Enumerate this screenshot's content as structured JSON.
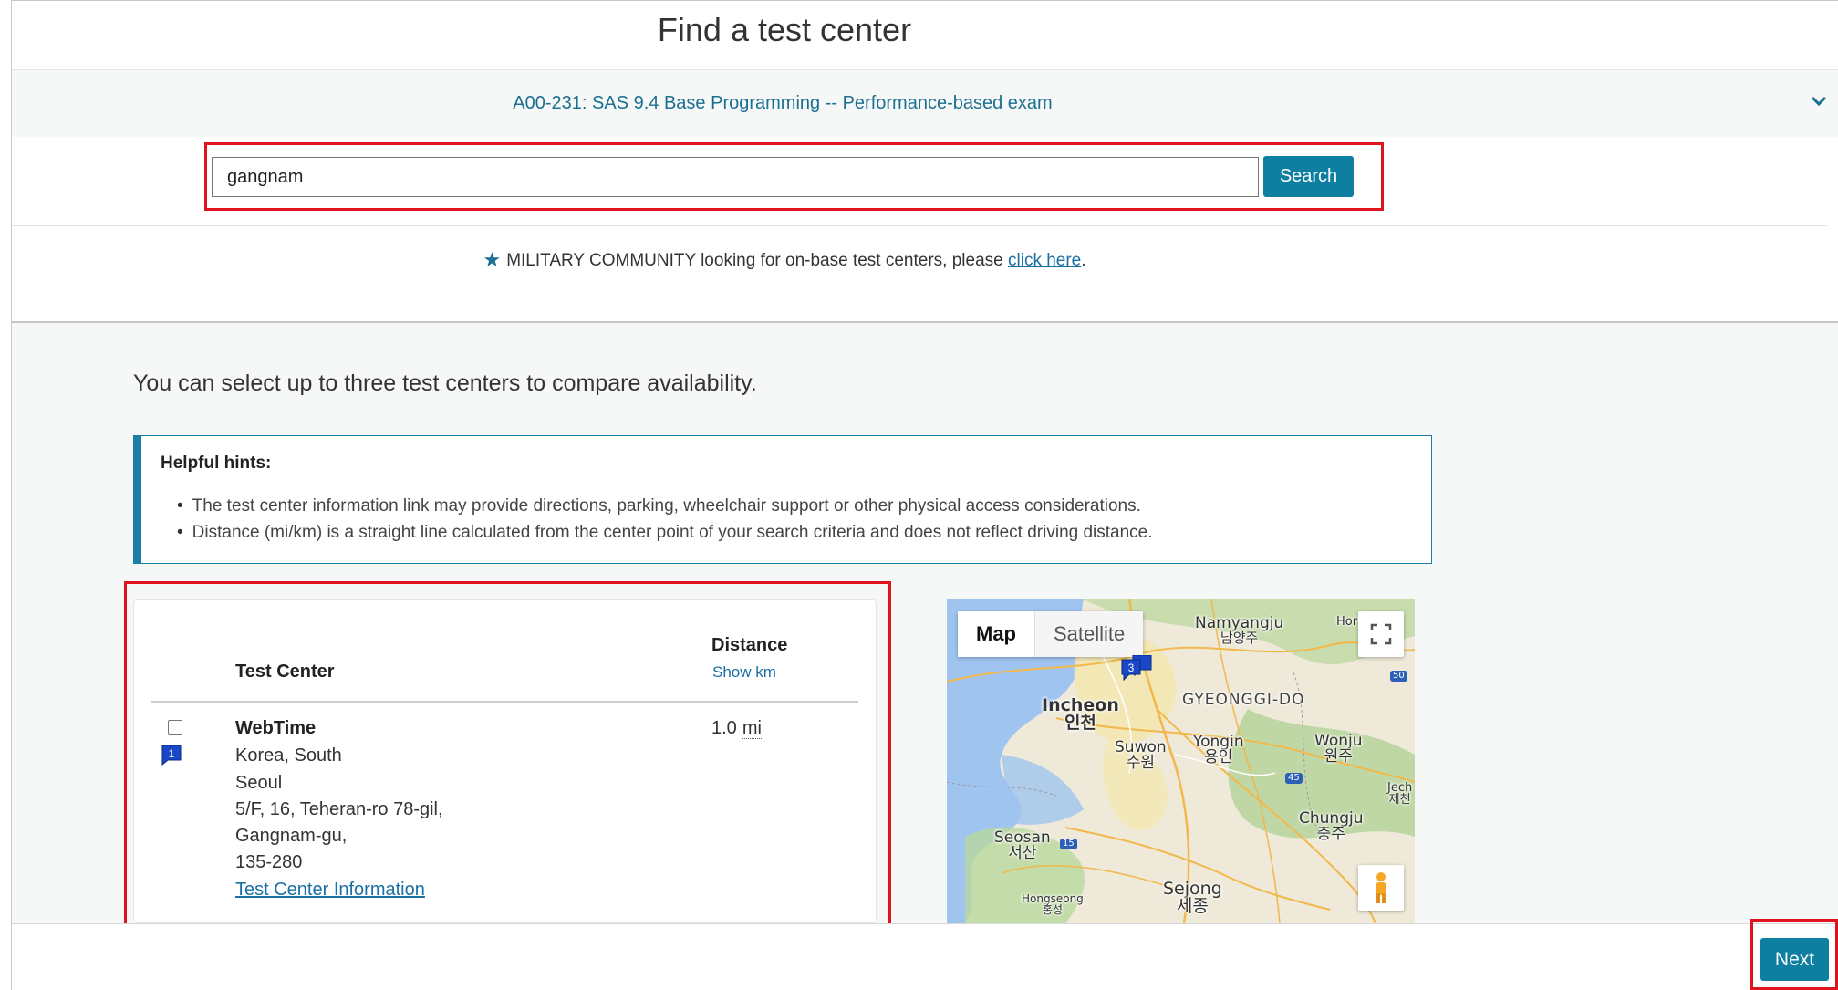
{
  "header": {
    "title": "Find a test center",
    "exam_name": "A00-231: SAS 9.4 Base Programming -- Performance-based exam"
  },
  "search": {
    "query": "gangnam",
    "button_label": "Search"
  },
  "military": {
    "text": "MILITARY COMMUNITY looking for on-base test centers, please ",
    "link_text": "click here",
    "suffix": "."
  },
  "intro": "You can select up to three test centers to compare availability.",
  "hints": {
    "title": "Helpful hints:",
    "items": [
      "The test center information link may provide directions, parking, wheelchair support or other physical access considerations.",
      "Distance (mi/km) is a straight line calculated from the center point of your search criteria and does not reflect driving distance."
    ]
  },
  "results": {
    "col_test_center": "Test Center",
    "col_distance": "Distance",
    "show_km": "Show km",
    "rows": [
      {
        "marker": "1",
        "name": "WebTime",
        "country": "Korea, South",
        "city": "Seoul",
        "address1": "5/F, 16, Teheran-ro 78-gil,",
        "address2": "Gangnam-gu,",
        "postal": "135-280",
        "info_link": "Test Center Information",
        "distance_value": "1.0",
        "distance_unit": "mi"
      }
    ]
  },
  "map": {
    "tab_map": "Map",
    "tab_satellite": "Satellite",
    "marker_label": "3",
    "labels": {
      "namyangju": "Namyangju",
      "namyangju_ko": "남양주",
      "hor": "Hor",
      "incheon": "Incheon",
      "incheon_ko": "인천",
      "gyeonggi": "GYEONGGI-DO",
      "suwon": "Suwon",
      "suwon_ko": "수원",
      "yongin": "Yongin",
      "yongin_ko": "용인",
      "wonju": "Wonju",
      "wonju_ko": "원주",
      "jec": "Jech",
      "jec_ko": "제천",
      "chungju": "Chungju",
      "chungju_ko": "충주",
      "seosan": "Seosan",
      "seosan_ko": "서산",
      "sejong": "Sejong",
      "sejong_ko": "세종",
      "hongseong": "Hongseong",
      "hongseong_ko": "홍성",
      "road_50": "50",
      "road_45": "45",
      "road_15": "15"
    }
  },
  "footer": {
    "next_label": "Next"
  },
  "colors": {
    "accent": "#0e7fa1",
    "link": "#1a6fa5",
    "highlight_box": "#e0141e"
  }
}
